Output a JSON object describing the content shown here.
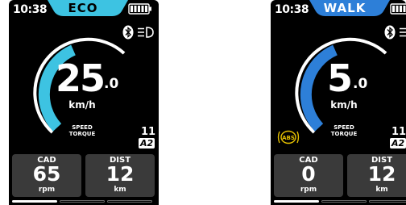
{
  "colors": {
    "eco_accent": "#3dc3e2",
    "walk_accent": "#2d7fd8",
    "gauge_track": "#ffffff",
    "panel_bg": "#3a3a3a",
    "abs_warning": "#e5c000"
  },
  "eco": {
    "time": "10:38",
    "mode": "ECO",
    "speed_integer": "25",
    "speed_decimal": ".0",
    "speed_unit": "km/h",
    "speed_fraction": 0.5,
    "mode_line1": "SPEED",
    "mode_line2": "TORQUE",
    "assist_level": "11",
    "assist_badge": "A2",
    "cad_label": "CAD",
    "cad_value": "65",
    "cad_unit": "rpm",
    "dist_label": "DIST",
    "dist_value": "12",
    "dist_unit": "km",
    "page_active": 0,
    "page_count": 3,
    "icons": [
      "battery-icon",
      "bluetooth-icon",
      "headlight-icon"
    ]
  },
  "walk": {
    "time": "10:38",
    "mode": "WALK",
    "speed_integer": "5",
    "speed_decimal": ".0",
    "speed_unit": "km/h",
    "speed_fraction": 0.33,
    "mode_line1": "SPEED",
    "mode_line2": "TORQUE",
    "assist_level": "11",
    "assist_badge": "A2",
    "abs_label": "ABS",
    "cad_label": "CAD",
    "cad_value": "0",
    "cad_unit": "rpm",
    "dist_label": "DIST",
    "dist_value": "12",
    "dist_unit": "km",
    "page_active": 0,
    "page_count": 3,
    "icons": [
      "battery-icon",
      "bluetooth-icon",
      "headlight-icon",
      "abs-warning-icon"
    ]
  }
}
